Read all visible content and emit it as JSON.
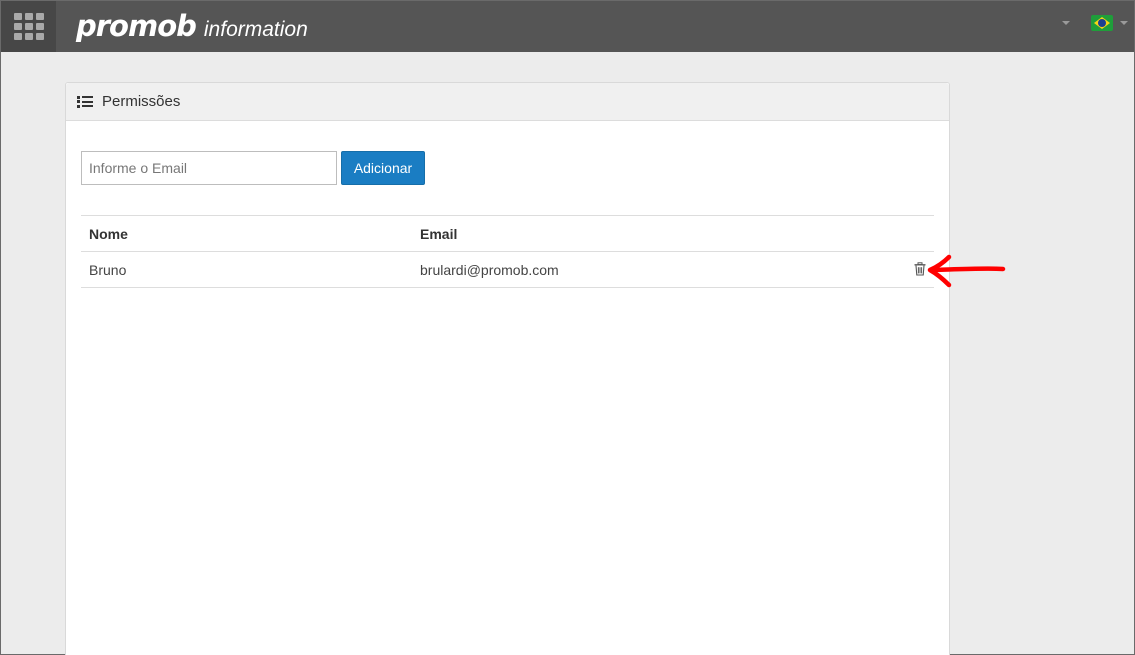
{
  "header": {
    "brand_main": "promob",
    "brand_sub": "information",
    "apps_icon": "grid-icon",
    "language_flag": "brazil-flag-icon",
    "colors": {
      "bar": "#555555",
      "apps_bg": "#474747"
    }
  },
  "panel": {
    "title": "Permissões",
    "title_icon": "list-icon"
  },
  "form": {
    "email_placeholder": "Informe o Email",
    "email_value": "",
    "add_label": "Adicionar",
    "button_color": "#1a7dc3"
  },
  "table": {
    "columns": [
      "Nome",
      "Email"
    ],
    "rows": [
      {
        "name": "Bruno",
        "email": "brulardi@promob.com",
        "action_icon": "trash-icon"
      }
    ]
  },
  "annotation": {
    "arrow_color": "#ff0000"
  }
}
